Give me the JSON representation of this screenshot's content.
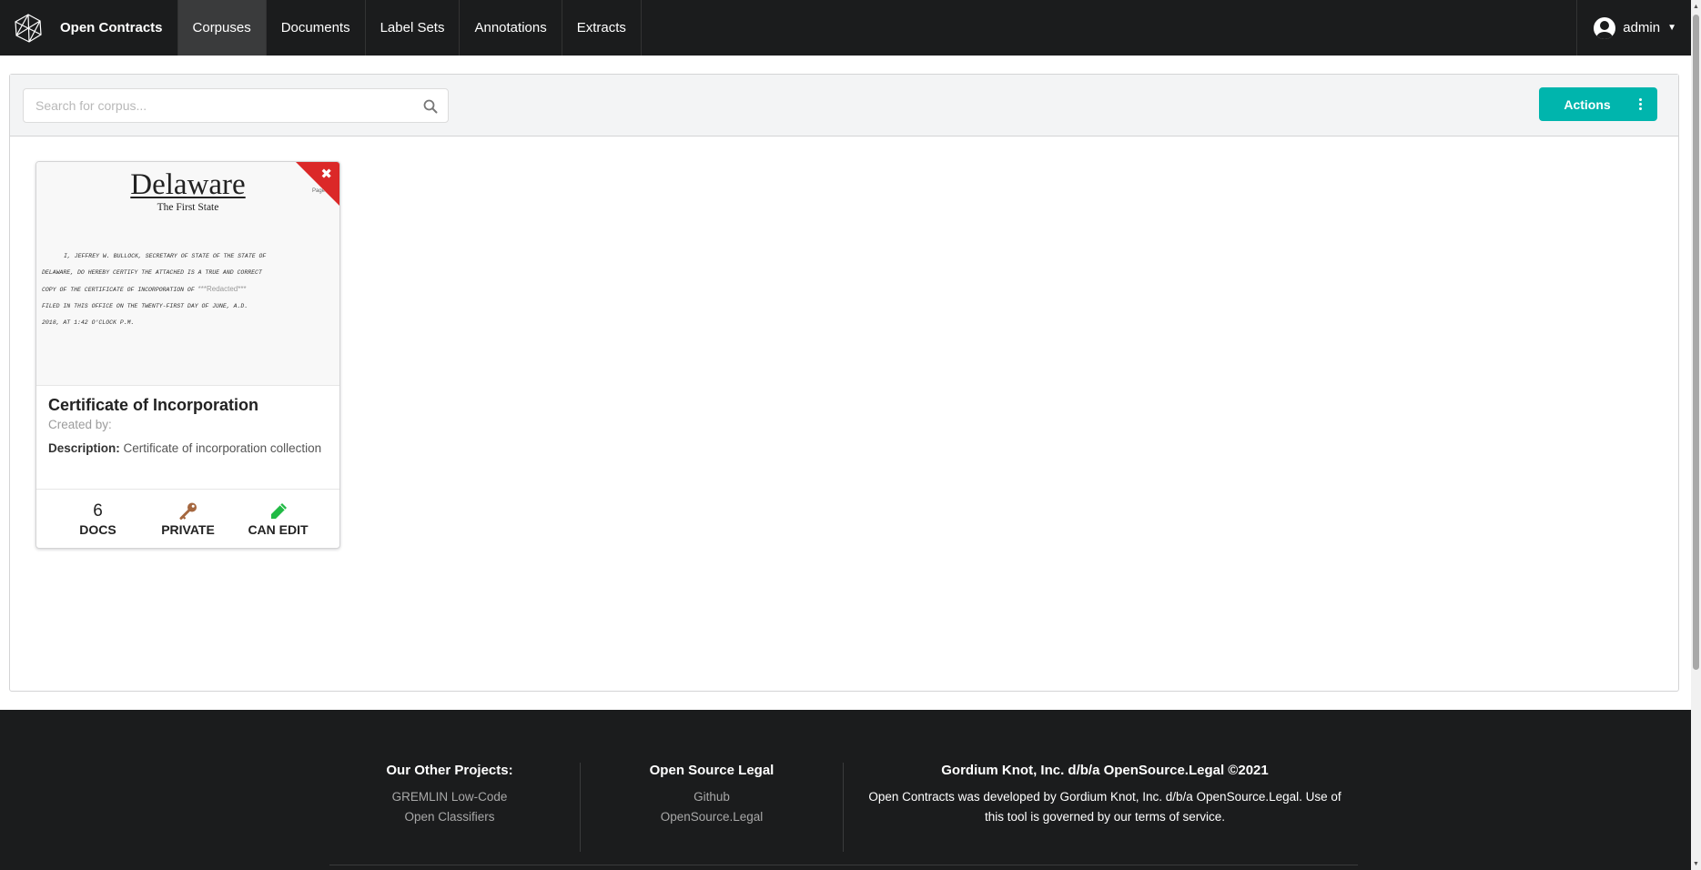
{
  "navbar": {
    "brand": "Open Contracts",
    "items": [
      {
        "label": "Corpuses",
        "active": true
      },
      {
        "label": "Documents",
        "active": false
      },
      {
        "label": "Label Sets",
        "active": false
      },
      {
        "label": "Annotations",
        "active": false
      },
      {
        "label": "Extracts",
        "active": false
      }
    ],
    "user": "admin"
  },
  "toolbar": {
    "search_placeholder": "Search for corpus...",
    "search_value": "",
    "actions_label": "Actions"
  },
  "corpus_card": {
    "thumbnail": {
      "title": "Delaware",
      "subtitle": "The First State",
      "body_line_1": "I, JEFFREY W. BULLOCK, SECRETARY OF STATE OF THE STATE OF",
      "body_line_2": "DELAWARE, DO HEREBY CERTIFY THE ATTACHED IS A TRUE AND CORRECT",
      "body_line_3_start": "COPY OF THE CERTIFICATE OF INCORPORATION OF",
      "body_redacted": "***Redacted***",
      "body_line_4": "FILED IN THIS OFFICE ON THE TWENTY-FIRST DAY OF JUNE, A.D.",
      "body_line_5": "2018, AT 1:42 O'CLOCK P.M.",
      "page_mark": "Page"
    },
    "title": "Certificate of Incorporation",
    "created_by_label": "Created by:",
    "description_label": "Description:",
    "description": "Certificate of incorporation collection",
    "stats": {
      "docs_count": "6",
      "docs_label": "DOCS",
      "visibility_label": "PRIVATE",
      "permission_label": "CAN EDIT"
    },
    "colors": {
      "ribbon": "#db2828",
      "key_icon": "#a5673f",
      "pencil_icon": "#21ba45"
    }
  },
  "footer": {
    "col1": {
      "heading": "Our Other Projects:",
      "links": [
        "GREMLIN Low-Code",
        "Open Classifiers"
      ]
    },
    "col2": {
      "heading": "Open Source Legal",
      "links": [
        "Github",
        "OpenSource.Legal"
      ]
    },
    "col3": {
      "heading": "Gordium Knot, Inc. d/b/a OpenSource.Legal ©2021",
      "text_line_1": "Open Contracts was developed by Gordium Knot, Inc. d/b/a OpenSource.Legal. Use of",
      "text_line_2": "this tool is governed by our terms of service."
    }
  },
  "colors": {
    "navbar_bg": "#1b1c1d",
    "accent_teal": "#00b5ad",
    "toolbar_bg": "#f3f4f5"
  }
}
